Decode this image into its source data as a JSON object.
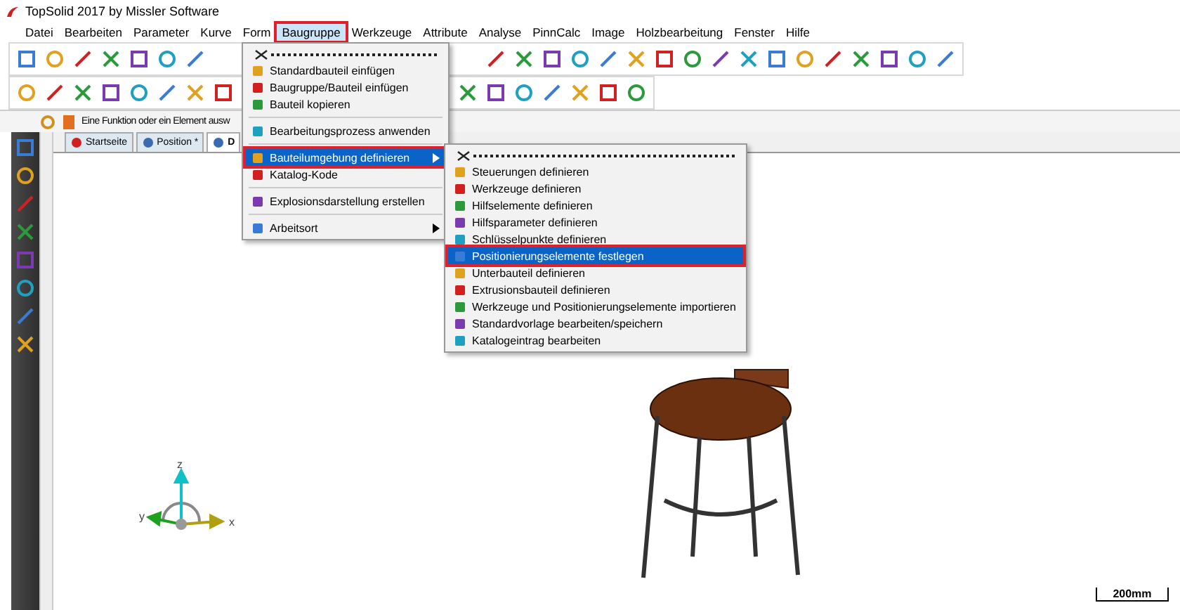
{
  "window": {
    "title": "TopSolid 2017 by Missler Software"
  },
  "menubar": [
    {
      "label": "Datei",
      "selected": false
    },
    {
      "label": "Bearbeiten",
      "selected": false
    },
    {
      "label": "Parameter",
      "selected": false
    },
    {
      "label": "Kurve",
      "selected": false
    },
    {
      "label": "Form",
      "selected": false
    },
    {
      "label": "Baugruppe",
      "selected": true
    },
    {
      "label": "Werkzeuge",
      "selected": false
    },
    {
      "label": "Attribute",
      "selected": false
    },
    {
      "label": "Analyse",
      "selected": false
    },
    {
      "label": "PinnCalc",
      "selected": false
    },
    {
      "label": "Image",
      "selected": false
    },
    {
      "label": "Holzbearbeitung",
      "selected": false
    },
    {
      "label": "Fenster",
      "selected": false
    },
    {
      "label": "Hilfe",
      "selected": false
    }
  ],
  "prompt": "Eine Funktion oder ein Element ausw",
  "tabs": [
    {
      "label": "Startseite",
      "selected": false
    },
    {
      "label": "Position *",
      "selected": false
    },
    {
      "label": "D",
      "selected": true
    }
  ],
  "menu": [
    {
      "kind": "tearoff"
    },
    {
      "kind": "item",
      "label": "Standardbauteil einfügen",
      "selected": false
    },
    {
      "kind": "item",
      "label": "Baugruppe/Bauteil einfügen",
      "selected": false
    },
    {
      "kind": "item",
      "label": "Bauteil kopieren",
      "selected": false
    },
    {
      "kind": "separator"
    },
    {
      "kind": "item",
      "label": "Bearbeitungsprozess anwenden",
      "selected": false
    },
    {
      "kind": "separator"
    },
    {
      "kind": "submenu",
      "label": "Bauteilumgebung definieren",
      "selected": true
    },
    {
      "kind": "item",
      "label": "Katalog-Kode",
      "selected": false
    },
    {
      "kind": "separator"
    },
    {
      "kind": "item",
      "label": "Explosionsdarstellung erstellen",
      "selected": false
    },
    {
      "kind": "separator"
    },
    {
      "kind": "submenu",
      "label": "Arbeitsort",
      "selected": false
    }
  ],
  "submenu": [
    {
      "kind": "tearoff"
    },
    {
      "kind": "item",
      "label": "Steuerungen definieren",
      "selected": false
    },
    {
      "kind": "item",
      "label": "Werkzeuge definieren",
      "selected": false
    },
    {
      "kind": "item",
      "label": "Hilfselemente definieren",
      "selected": false
    },
    {
      "kind": "item",
      "label": "Hilfsparameter definieren",
      "selected": false
    },
    {
      "kind": "item",
      "label": "Schlüsselpunkte definieren",
      "selected": false
    },
    {
      "kind": "item",
      "label": "Positionierungselemente festlegen",
      "selected": true
    },
    {
      "kind": "item",
      "label": "Unterbauteil definieren",
      "selected": false
    },
    {
      "kind": "item",
      "label": "Extrusionsbauteil definieren",
      "selected": false
    },
    {
      "kind": "item",
      "label": "Werkzeuge und Positionierungselemente importieren",
      "selected": false
    },
    {
      "kind": "item",
      "label": "Standardvorlage bearbeiten/speichern",
      "selected": false
    },
    {
      "kind": "item",
      "label": "Katalogeintrag bearbeiten",
      "selected": false
    }
  ],
  "axes": {
    "x": "x",
    "y": "y",
    "z": "z"
  },
  "scale": "200mm"
}
